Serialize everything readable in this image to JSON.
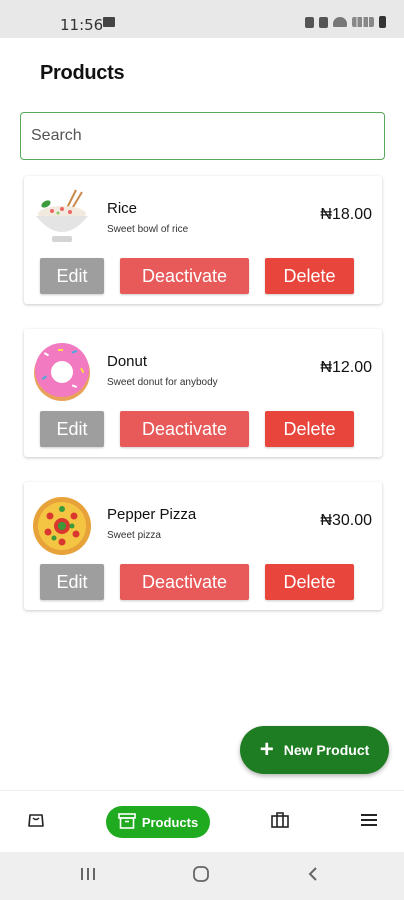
{
  "status_bar": {
    "time": "11:56"
  },
  "header": {
    "title": "Products"
  },
  "search": {
    "placeholder": "Search"
  },
  "products": [
    {
      "name": "Rice",
      "description": "Sweet bowl of rice",
      "price": "₦18.00",
      "edit_label": "Edit",
      "deactivate_label": "Deactivate",
      "delete_label": "Delete"
    },
    {
      "name": "Donut",
      "description": "Sweet donut for anybody",
      "price": "₦12.00",
      "edit_label": "Edit",
      "deactivate_label": "Deactivate",
      "delete_label": "Delete"
    },
    {
      "name": "Pepper Pizza",
      "description": "Sweet pizza",
      "price": "₦30.00",
      "edit_label": "Edit",
      "deactivate_label": "Deactivate",
      "delete_label": "Delete"
    }
  ],
  "fab": {
    "label": "New Product"
  },
  "bottom_nav": {
    "items": [
      {
        "icon": "orders-icon"
      },
      {
        "icon": "products-icon",
        "label": "Products",
        "active": true
      },
      {
        "icon": "store-icon"
      },
      {
        "icon": "menu-icon"
      }
    ]
  },
  "colors": {
    "accent": "#1faa1f",
    "fab": "#1e7d22",
    "delete": "#e8453c",
    "deactivate": "#e85a5a",
    "edit": "#9e9e9e"
  }
}
